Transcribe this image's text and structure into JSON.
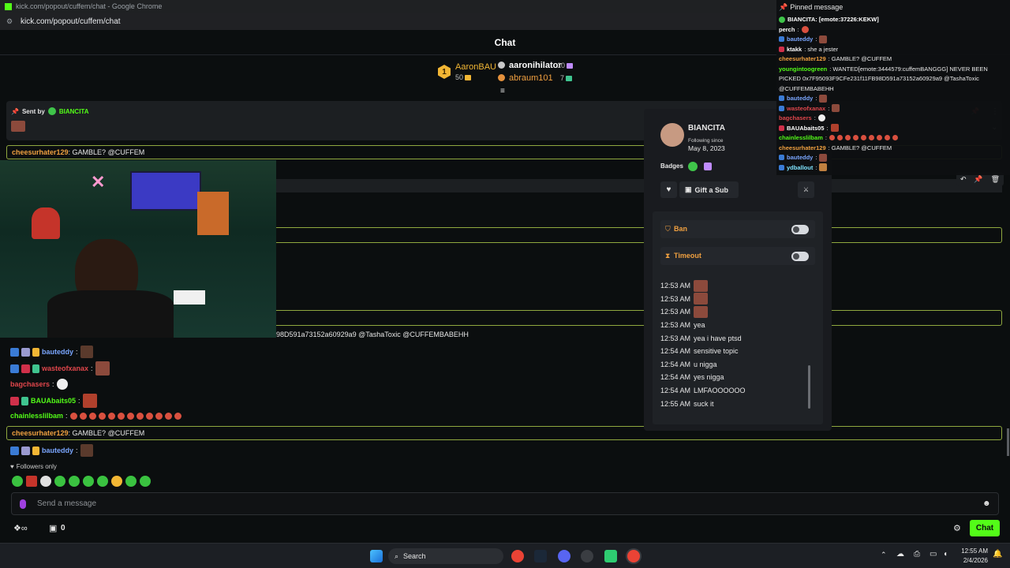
{
  "browser": {
    "title": "kick.com/popout/cuffem/chat - Google Chrome",
    "url": "kick.com/popout/cuffem/chat"
  },
  "chat_header": {
    "title": "Chat"
  },
  "leaderboard": {
    "first": {
      "rank": "1",
      "name": "AaronBAU",
      "count": "50"
    },
    "second": {
      "name": "aaronihilator",
      "count": "10"
    },
    "third": {
      "name": "abraum101",
      "count": "7"
    }
  },
  "pinned_bar": {
    "sent_by_label": "Sent by",
    "sender": "BIANCITA"
  },
  "highlight_rows": [
    {
      "user": "cheesurhater129",
      "text": ": GAMBLE? @CUFFEM"
    },
    {
      "user": "cheesurhater129",
      "text": ": GAMBLE? @CUFFEM"
    }
  ],
  "partial_text": "98D591a73152a60929a9 @TashaToxic @CUFFEMBABEHH",
  "chat_lines": [
    {
      "user": "bauteddy",
      "text": ":"
    },
    {
      "user": "wasteofxanax",
      "text": ":"
    },
    {
      "user": "bagchasers",
      "text": ":"
    },
    {
      "user": "BAUAbaits05",
      "text": ":"
    },
    {
      "user": "chainlesslilbam",
      "text": ":"
    },
    {
      "user": "bauteddy",
      "text": ":"
    }
  ],
  "usercard": {
    "name": "BIANCITA",
    "following_label": "Following since",
    "following_date": "May 8, 2023",
    "badges_label": "Badges",
    "gift_label": "Gift a Sub",
    "ban_label": "Ban",
    "timeout_label": "Timeout",
    "log": [
      {
        "time": "12:53 AM",
        "text": ""
      },
      {
        "time": "12:53 AM",
        "text": ""
      },
      {
        "time": "12:53 AM",
        "text": ""
      },
      {
        "time": "12:53 AM",
        "text": "yea"
      },
      {
        "time": "12:53 AM",
        "text": "yea i have ptsd"
      },
      {
        "time": "12:54 AM",
        "text": "sensitive topic"
      },
      {
        "time": "12:54 AM",
        "text": "u nigga"
      },
      {
        "time": "12:54 AM",
        "text": "yes nigga"
      },
      {
        "time": "12:54 AM",
        "text": "LMFAOOOOOO"
      },
      {
        "time": "12:55 AM",
        "text": "suck it"
      }
    ]
  },
  "popout": {
    "pinned_label": "Pinned message",
    "pinned_text": "BIANCITA: [emote:37226:KEKW]",
    "lines": [
      {
        "user": "perch",
        "text": ":"
      },
      {
        "user": "bauteddy",
        "text": ":"
      },
      {
        "user": "ktakk",
        "text": ": she a jester"
      },
      {
        "user": "cheesurhater129",
        "text": ": GAMBLE? @CUFFEM"
      },
      {
        "user": "youngintoogreen",
        "text": ": WANTED[emote:3444579:cuffemBANGGG] NEVER BEEN"
      },
      {
        "user": "",
        "text": "PICKED 0x7F95093F9CFe231f11FB98D591a73152a60929a9 @TashaToxic"
      },
      {
        "user": "",
        "text": "@CUFFEMBABEHH"
      },
      {
        "user": "bauteddy",
        "text": ":"
      },
      {
        "user": "wasteofxanax",
        "text": ":"
      },
      {
        "user": "bagchasers",
        "text": ":"
      },
      {
        "user": "BAUAbaits05",
        "text": ":"
      },
      {
        "user": "chainlesslilbam",
        "text": ":"
      },
      {
        "user": "cheesurhater129",
        "text": ": GAMBLE? @CUFFEM"
      },
      {
        "user": "bauteddy",
        "text": ":"
      },
      {
        "user": "ydballout",
        "text": ":"
      }
    ]
  },
  "followers_only": "Followers only",
  "message_placeholder": "Send a message",
  "bottom": {
    "count": "0",
    "chat_button": "Chat"
  },
  "taskbar": {
    "search": "Search",
    "time": "12:55 AM",
    "date": "2/4/2026"
  },
  "colors": {
    "kick_green": "#53fc18",
    "highlight_border": "#8fa83f",
    "gold": "#f2b634"
  }
}
